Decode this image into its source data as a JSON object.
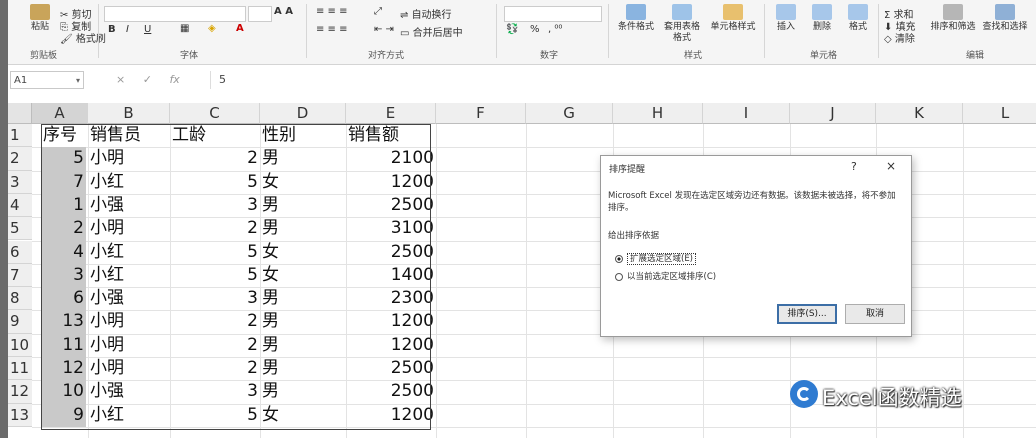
{
  "ribbon": {
    "clipboard": {
      "paste_label": "粘贴",
      "cut": "剪切",
      "copy": "复制",
      "format_painter": "格式刷",
      "group": "剪贴板"
    },
    "font": {
      "bold": "B",
      "italic": "I",
      "underline": "U",
      "group": "字体"
    },
    "alignment": {
      "wrap": "自动换行",
      "merge": "合并后居中",
      "group": "对齐方式"
    },
    "number": {
      "percent": "%",
      "group": "数字"
    },
    "styles": {
      "cond_format": "条件格式",
      "table_format": "套用表格格式",
      "cell_styles": "单元格样式",
      "group": "样式"
    },
    "cells": {
      "insert": "插入",
      "delete": "删除",
      "format": "格式",
      "group": "单元格"
    },
    "editing": {
      "sum": "求和",
      "fill": "填充",
      "clear": "清除",
      "sort_filter": "排序和筛选",
      "find_select": "查找和选择",
      "group": "编辑"
    }
  },
  "formula_bar": {
    "name_box": "A1",
    "cancel": "×",
    "enter": "✓",
    "fx": "fx",
    "content": "5"
  },
  "columns": [
    "A",
    "B",
    "C",
    "D",
    "E",
    "F",
    "G",
    "H",
    "I",
    "J",
    "K",
    "L"
  ],
  "rows": [
    "1",
    "2",
    "3",
    "4",
    "5",
    "6",
    "7",
    "8",
    "9",
    "10",
    "11",
    "12",
    "13"
  ],
  "table": {
    "headers": [
      "序号",
      "销售员",
      "工龄",
      "性别",
      "销售额"
    ],
    "rows": [
      [
        "5",
        "小明",
        "2",
        "男",
        "2100"
      ],
      [
        "7",
        "小红",
        "5",
        "女",
        "1200"
      ],
      [
        "1",
        "小强",
        "3",
        "男",
        "2500"
      ],
      [
        "2",
        "小明",
        "2",
        "男",
        "3100"
      ],
      [
        "4",
        "小红",
        "5",
        "女",
        "2500"
      ],
      [
        "3",
        "小红",
        "5",
        "女",
        "1400"
      ],
      [
        "6",
        "小强",
        "3",
        "男",
        "2300"
      ],
      [
        "13",
        "小明",
        "2",
        "男",
        "1200"
      ],
      [
        "11",
        "小明",
        "2",
        "男",
        "1200"
      ],
      [
        "12",
        "小明",
        "2",
        "男",
        "2500"
      ],
      [
        "10",
        "小强",
        "3",
        "男",
        "2500"
      ],
      [
        "9",
        "小红",
        "5",
        "女",
        "1200"
      ]
    ]
  },
  "dialog": {
    "title": "排序提醒",
    "help": "?",
    "close": "×",
    "message": "Microsoft Excel 发现在选定区域旁边还有数据。该数据未被选择，将不参加排序。",
    "label": "给出排序依据",
    "option_expand": "扩展选定区域(E)",
    "option_current": "以当前选定区域排序(C)",
    "sort_button": "排序(S)...",
    "cancel_button": "取消"
  },
  "watermark": {
    "text": "Excel函数精选",
    "icon": "e-logo-icon"
  }
}
